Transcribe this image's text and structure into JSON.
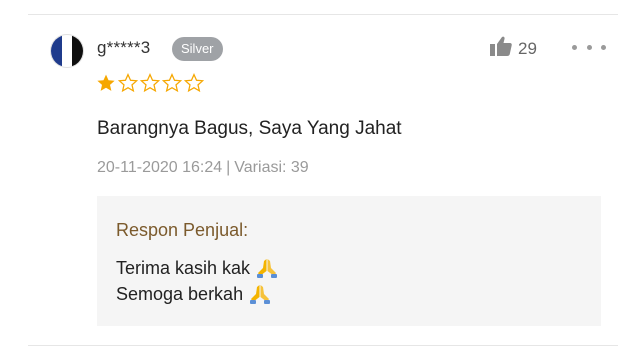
{
  "review": {
    "username": "g*****3",
    "badge": "Silver",
    "rating": 1,
    "max_rating": 5,
    "text": "Barangnya Bagus, Saya Yang Jahat",
    "date": "20-11-2020 16:24",
    "separator": "|",
    "variant": "Variasi: 39",
    "likes": "29",
    "icons": {
      "like": "thumbs-up-icon",
      "more": "more-options-icon",
      "star": "star-icon"
    }
  },
  "seller_response": {
    "title": "Respon Penjual:",
    "line1": "Terima kasih kak",
    "line2": "Semoga berkah",
    "emoji_icon": "praying-hands-icon"
  },
  "colors": {
    "star_filled": "#f6a700",
    "star_empty_stroke": "#f6a700",
    "badge_bg": "#9fa2a6",
    "response_title": "#7b5a2c",
    "response_bg": "#f5f5f5"
  }
}
